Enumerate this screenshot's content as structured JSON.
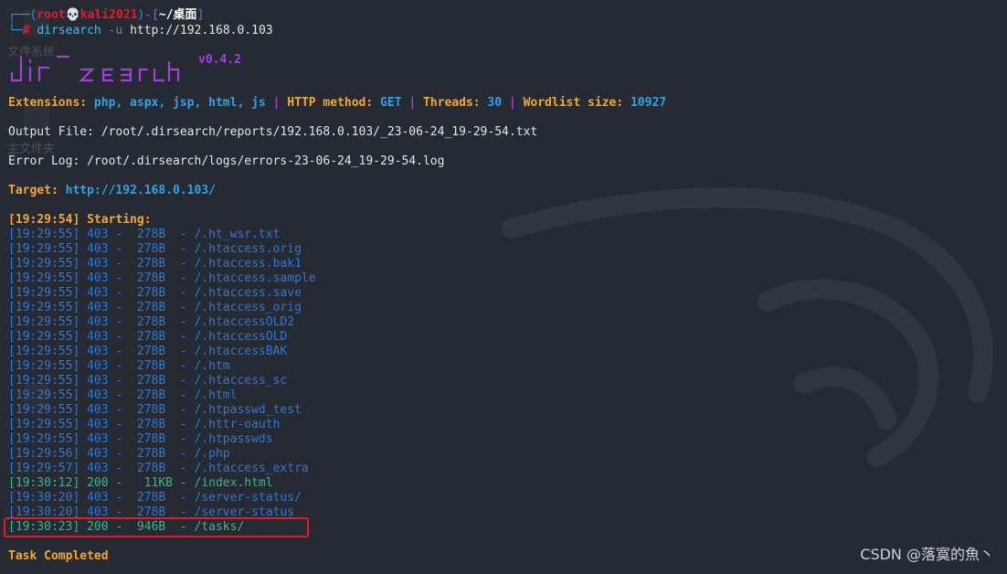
{
  "prompt": {
    "frame_top": "┌──(",
    "user": "root💀kali2021",
    "frame_mid": ")-[",
    "dir": "~/桌面",
    "frame_end": "]",
    "frame_bottom": "└─",
    "hash": "#"
  },
  "command": {
    "name": "dirsearch",
    "flag": "-u",
    "url": "http://192.168.0.103"
  },
  "banner": {
    "logo_art": "dirsearch",
    "version": "v0.4.2"
  },
  "config": {
    "extensions_label": "Extensions:",
    "extensions_value": "php, aspx, jsp, html, js",
    "method_label": "HTTP method:",
    "method_value": "GET",
    "threads_label": "Threads:",
    "threads_value": "30",
    "wordlist_label": "Wordlist size:",
    "wordlist_value": "10927",
    "separator": "|"
  },
  "output_file": "Output File: /root/.dirsearch/reports/192.168.0.103/_23-06-24_19-29-54.txt",
  "error_log": "Error Log: /root/.dirsearch/logs/errors-23-06-24_19-29-54.log",
  "target": {
    "label": "Target:",
    "url": "http://192.168.0.103/"
  },
  "starting": "[19:29:54] Starting:",
  "results": [
    {
      "text": "[19:29:55] 403 -  278B  - /.ht_wsr.txt",
      "status": "403"
    },
    {
      "text": "[19:29:55] 403 -  278B  - /.htaccess.orig",
      "status": "403"
    },
    {
      "text": "[19:29:55] 403 -  278B  - /.htaccess.bak1",
      "status": "403"
    },
    {
      "text": "[19:29:55] 403 -  278B  - /.htaccess.sample",
      "status": "403"
    },
    {
      "text": "[19:29:55] 403 -  278B  - /.htaccess.save",
      "status": "403"
    },
    {
      "text": "[19:29:55] 403 -  278B  - /.htaccess_orig",
      "status": "403"
    },
    {
      "text": "[19:29:55] 403 -  278B  - /.htaccessOLD2",
      "status": "403"
    },
    {
      "text": "[19:29:55] 403 -  278B  - /.htaccessOLD",
      "status": "403"
    },
    {
      "text": "[19:29:55] 403 -  278B  - /.htaccessBAK",
      "status": "403"
    },
    {
      "text": "[19:29:55] 403 -  278B  - /.htm",
      "status": "403"
    },
    {
      "text": "[19:29:55] 403 -  278B  - /.htaccess_sc",
      "status": "403"
    },
    {
      "text": "[19:29:55] 403 -  278B  - /.html",
      "status": "403"
    },
    {
      "text": "[19:29:55] 403 -  278B  - /.htpasswd_test",
      "status": "403"
    },
    {
      "text": "[19:29:55] 403 -  278B  - /.httr-oauth",
      "status": "403"
    },
    {
      "text": "[19:29:55] 403 -  278B  - /.htpasswds",
      "status": "403"
    },
    {
      "text": "[19:29:56] 403 -  278B  - /.php",
      "status": "403"
    },
    {
      "text": "[19:29:57] 403 -  278B  - /.htaccess_extra",
      "status": "403"
    },
    {
      "text": "[19:30:12] 200 -   11KB - /index.html",
      "status": "200"
    },
    {
      "text": "[19:30:20] 403 -  278B  - /server-status/",
      "status": "403"
    },
    {
      "text": "[19:30:20] 403 -  278B  - /server-status",
      "status": "403"
    },
    {
      "text": "[19:30:23] 200 -  946B  - /tasks/",
      "status": "200"
    }
  ],
  "completed": "Task Completed",
  "background_labels": {
    "label1": "文件系统",
    "label2": "主文件夹"
  },
  "watermark": "CSDN @落寞的魚丶",
  "colors": {
    "background": "#262a33",
    "orange": "#f8a629",
    "cyan": "#2fa3e9",
    "purple": "#a23fe0",
    "status_403": "#2f77d6",
    "status_200": "#3bb58e",
    "highlight_box": "#e6192d"
  }
}
